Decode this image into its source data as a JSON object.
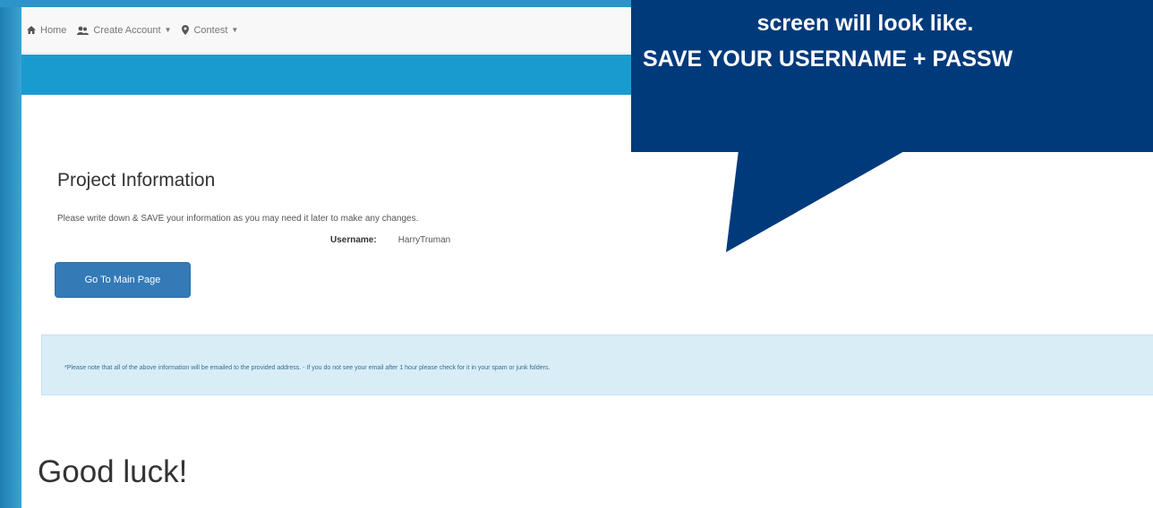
{
  "navbar": {
    "home_label": "Home",
    "create_account_label": "Create Account",
    "contest_label": "Contest",
    "icons": {
      "home": "home-icon",
      "create_account": "users-icon",
      "contest": "map-marker-icon"
    }
  },
  "main": {
    "section_title": "Project Information",
    "instructions": "Please write down & SAVE your information as you may need it later to make any changes.",
    "username_label": "Username:",
    "username_value": "HarryTruman",
    "main_page_button": "Go To Main Page",
    "alert_text": "*Please note that all of the above information will be emailed to the provided address. - If you do not see your email after 1 hour please check for it in your spam or junk folders.",
    "closing": "Good luck!"
  },
  "callout": {
    "line1": "screen will look like.",
    "line2": "SAVE YOUR USERNAME + PASSW"
  },
  "colors": {
    "navbar_bg": "#f8f8f8",
    "band_blue": "#1a9bd0",
    "button_blue": "#337ab7",
    "alert_bg": "#d9edf7",
    "callout_navy": "#013a7b"
  }
}
